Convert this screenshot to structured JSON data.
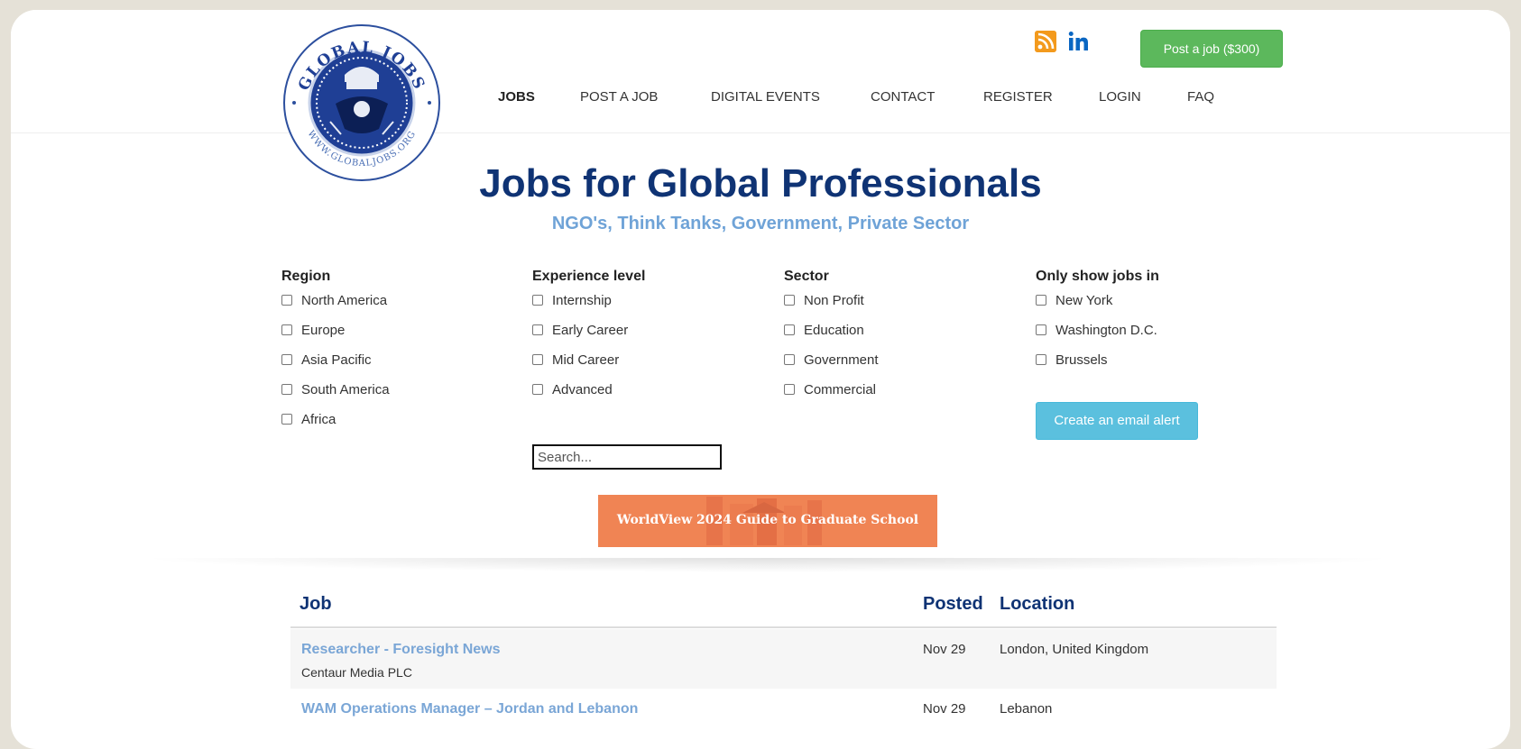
{
  "header": {
    "logo_text_top": "GLOBAL JOBS",
    "logo_text_bottom": "WWW.GLOBALJOBS.ORG",
    "nav": [
      {
        "label": "JOBS",
        "active": true
      },
      {
        "label": "POST A JOB",
        "active": false
      },
      {
        "label": "DIGITAL EVENTS",
        "active": false
      },
      {
        "label": "CONTACT",
        "active": false
      },
      {
        "label": "REGISTER",
        "active": false
      },
      {
        "label": "LOGIN",
        "active": false
      },
      {
        "label": "FAQ",
        "active": false
      }
    ],
    "social_icons": [
      "rss-icon",
      "linkedin-icon"
    ],
    "post_job_label": "Post a job ($300)"
  },
  "hero": {
    "title": "Jobs for Global Professionals",
    "subtitle": "NGO's, Think Tanks, Government, Private Sector"
  },
  "filters": [
    {
      "heading": "Region",
      "options": [
        "North America",
        "Europe",
        "Asia Pacific",
        "South America",
        "Africa"
      ]
    },
    {
      "heading": "Experience level",
      "options": [
        "Internship",
        "Early Career",
        "Mid Career",
        "Advanced"
      ]
    },
    {
      "heading": "Sector",
      "options": [
        "Non Profit",
        "Education",
        "Government",
        "Commercial"
      ]
    },
    {
      "heading": "Only show jobs in",
      "options": [
        "New York",
        "Washington D.C.",
        "Brussels"
      ]
    }
  ],
  "search": {
    "placeholder": "Search...",
    "value": ""
  },
  "email_alert_label": "Create an email alert",
  "banner": {
    "text": "WorldView 2024 Guide to Graduate School"
  },
  "table": {
    "headers": {
      "job": "Job",
      "posted": "Posted",
      "location": "Location"
    },
    "rows": [
      {
        "title": "Researcher - Foresight News",
        "org": "Centaur Media PLC",
        "posted": "Nov 29",
        "location": "London, United Kingdom"
      },
      {
        "title": "WAM Operations Manager – Jordan and Lebanon",
        "org": "",
        "posted": "Nov 29",
        "location": "Lebanon"
      }
    ]
  },
  "colors": {
    "brand_navy": "#0f3374",
    "link_blue": "#7aa6d6",
    "button_green": "#5cb85c",
    "button_cyan": "#5bc0de",
    "banner_orange": "#f08454"
  }
}
